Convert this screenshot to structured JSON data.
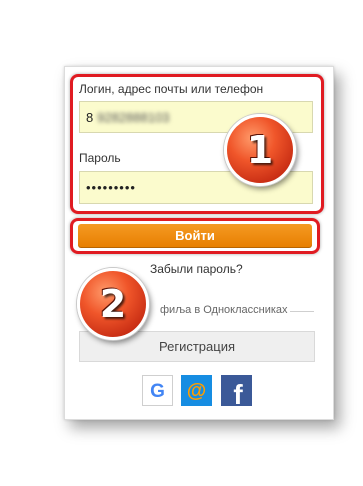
{
  "form": {
    "login_label": "Логин, адрес почты или телефон",
    "login_value": "8",
    "login_value_blurred": "9282888103",
    "password_label": "Пароль",
    "password_value": "•••••••••",
    "login_button": "Войти",
    "forgot_link": "Забыли пароль?"
  },
  "register": {
    "profile_text": "фиља в Одноклассниках",
    "register_button": "Регистрация"
  },
  "social": {
    "icons": [
      "google-icon",
      "mail-ru-icon",
      "facebook-icon"
    ],
    "google_letter": "G",
    "mail_symbol": "@",
    "facebook_letter": "f"
  },
  "annotations": {
    "step1": "1",
    "step2": "2",
    "highlight_color": "#e01b22"
  },
  "colors": {
    "button_orange": "#ee8208",
    "field_bg": "#fbfbcd",
    "facebook": "#3b5998",
    "mail_blue": "#168de2"
  }
}
